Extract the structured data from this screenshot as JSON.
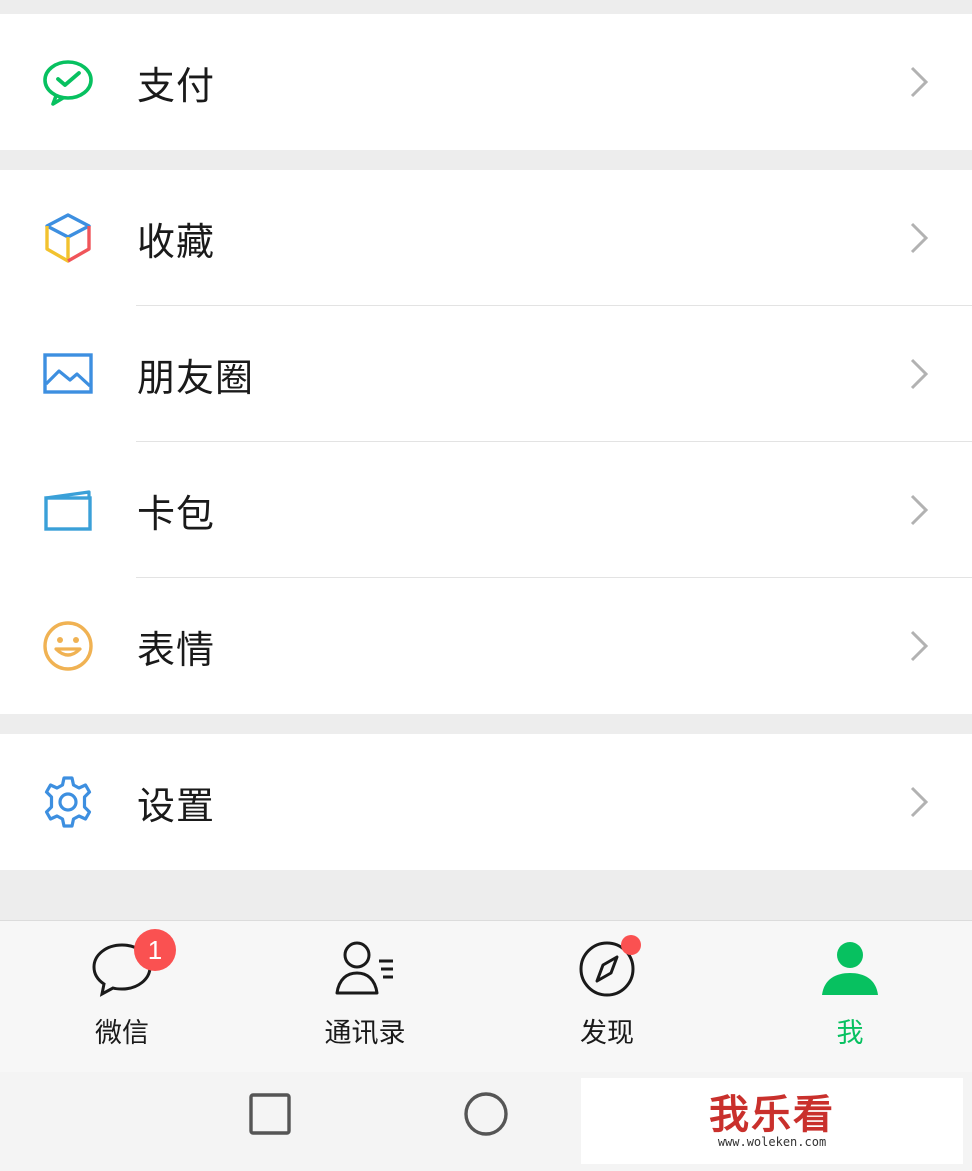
{
  "groups": [
    {
      "items": [
        {
          "label": "支付",
          "icon": "wechat-pay-icon"
        }
      ]
    },
    {
      "items": [
        {
          "label": "收藏",
          "icon": "favorites-cube-icon"
        },
        {
          "label": "朋友圈",
          "icon": "moments-picture-icon"
        },
        {
          "label": "卡包",
          "icon": "card-wallet-icon"
        },
        {
          "label": "表情",
          "icon": "smiley-face-icon"
        }
      ]
    },
    {
      "items": [
        {
          "label": "设置",
          "icon": "gear-icon"
        }
      ]
    }
  ],
  "tabbar": {
    "tabs": [
      {
        "label": "微信",
        "icon": "chat-bubble-icon",
        "badge": "1"
      },
      {
        "label": "通讯录",
        "icon": "contacts-icon"
      },
      {
        "label": "发现",
        "icon": "compass-icon",
        "dot": true
      },
      {
        "label": "我",
        "icon": "person-icon",
        "active": true
      }
    ]
  },
  "colors": {
    "accent": "#07c160",
    "badge": "#fa5151",
    "background": "#ededed"
  },
  "watermark": {
    "text": "我乐看",
    "sub": "www.woleken.com"
  }
}
